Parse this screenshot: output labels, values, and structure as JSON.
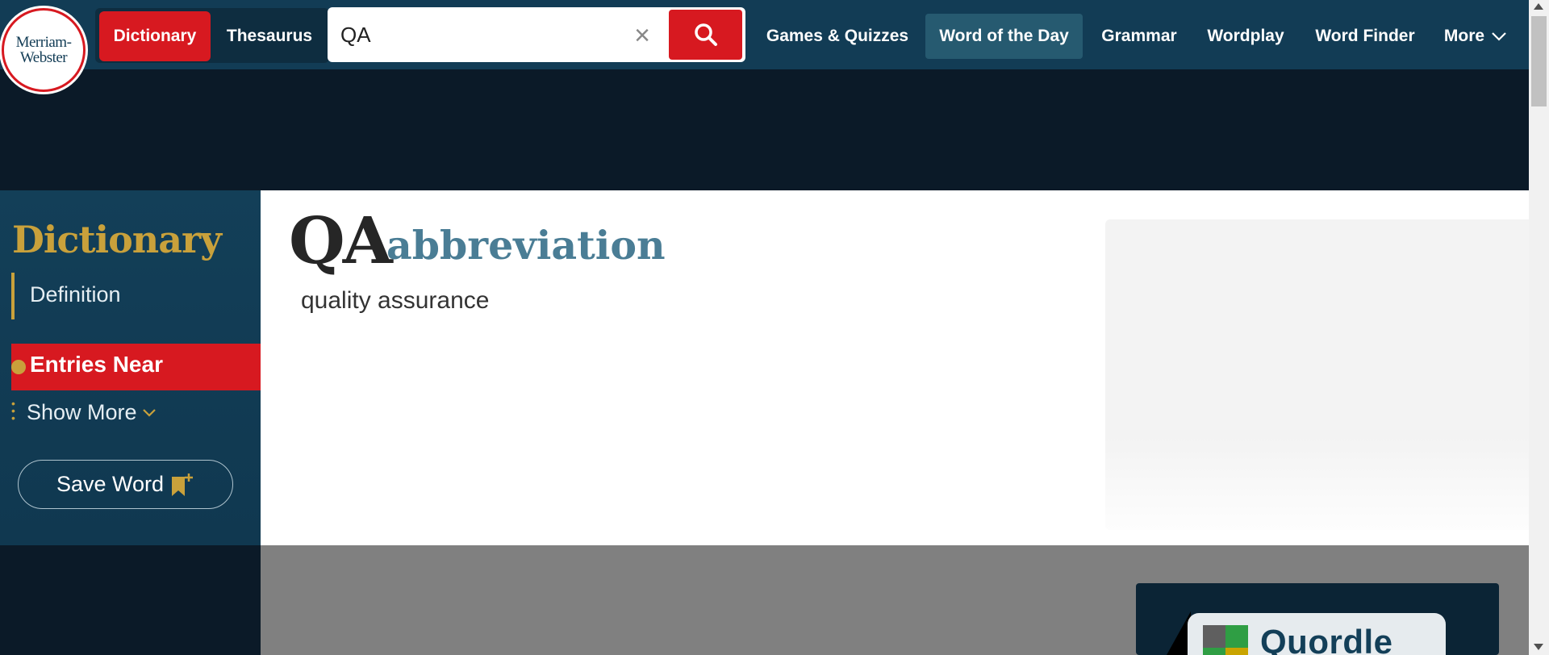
{
  "header": {
    "logo_line1": "Merriam-",
    "logo_line2": "Webster",
    "tab_dictionary": "Dictionary",
    "tab_thesaurus": "Thesaurus",
    "search_value": "QA",
    "nav": {
      "games": "Games & Quizzes",
      "wotd": "Word of the Day",
      "grammar": "Grammar",
      "wordplay": "Wordplay",
      "finder": "Word Finder",
      "more": "More"
    }
  },
  "sidebar": {
    "title": "Dictionary",
    "definition": "Definition",
    "entries_near": "Entries Near",
    "show_more": "Show More",
    "save_word": "Save Word"
  },
  "entry": {
    "headword": "QA",
    "part_of_speech": "abbreviation",
    "definition": "quality assurance"
  },
  "promo": {
    "label": "Quordle"
  },
  "colors": {
    "brand_red": "#d71920",
    "nav_blue": "#123c55",
    "gold": "#c9a13b",
    "pos_blue": "#4a7d95"
  }
}
